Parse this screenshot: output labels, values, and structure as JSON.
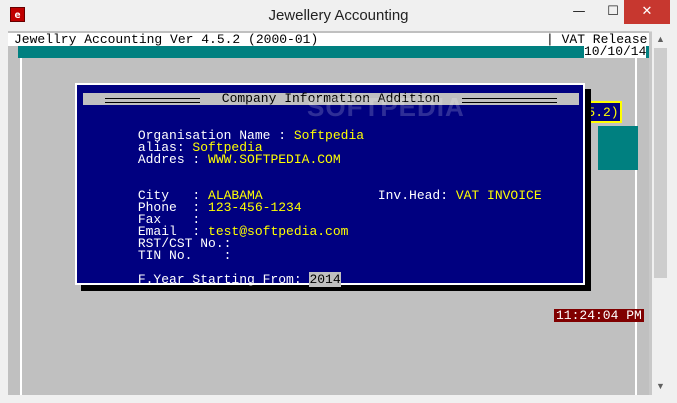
{
  "window": {
    "title": "Jewellery Accounting",
    "icon_label": "e",
    "controls": {
      "minimize": "—",
      "maximize": "☐",
      "close": "✕"
    }
  },
  "console": {
    "header_left": "Jewellry Accounting Ver 4.5.2 (2000-01)",
    "header_right": "| VAT Release",
    "date": "10/10/14",
    "partial_label": "5.2)",
    "clock": "11:24:04 PM"
  },
  "dialog": {
    "title": "Company Information Addition",
    "watermark": "SOFTPEDIA",
    "fields": {
      "org_name_label": "Organisation Name : ",
      "org_name_value": "Softpedia",
      "alias_label": "alias: ",
      "alias_value": "Softpedia",
      "address_label": "Addres : ",
      "address_value": "WWW.SOFTPEDIA.COM",
      "city_label": "City   : ",
      "city_value": "ALABAMA",
      "invhead_label": "Inv.Head: ",
      "invhead_value": "VAT INVOICE",
      "phone_label": "Phone  : ",
      "phone_value": "123-456-1234",
      "fax_label": "Fax    :",
      "email_label": "Email  : ",
      "email_value": "test@softpedia.com",
      "rst_label": "RST/CST No.:",
      "tin_label": "TIN No.    :",
      "fyear_label": "F.Year Starting From: ",
      "fyear_value": "2014"
    }
  },
  "colors": {
    "console_bg": "#c0c0c0",
    "dialog_bg": "#000080",
    "value_yellow": "#ffff00",
    "teal": "#008080",
    "clock_bg": "#800000"
  }
}
